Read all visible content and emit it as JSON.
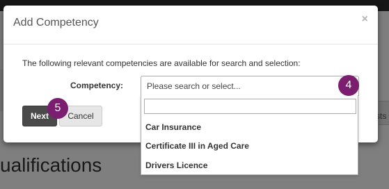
{
  "background": {
    "heading": "ualifications",
    "right_text": "sts"
  },
  "modal": {
    "title": "Add Competency",
    "close_symbol": "×",
    "description": "The following relevant competencies are available for search and selection:",
    "field_label": "Competency:",
    "select_placeholder": "Please search or select...",
    "next_label": "Next",
    "cancel_label": "Cancel"
  },
  "dropdown": {
    "search_value": "",
    "options": [
      "Car Insurance",
      "Certificate III in Aged Care",
      "Drivers Licence"
    ]
  },
  "markers": {
    "step_select": "4",
    "step_next": "5",
    "color": "#7b1e6f"
  }
}
